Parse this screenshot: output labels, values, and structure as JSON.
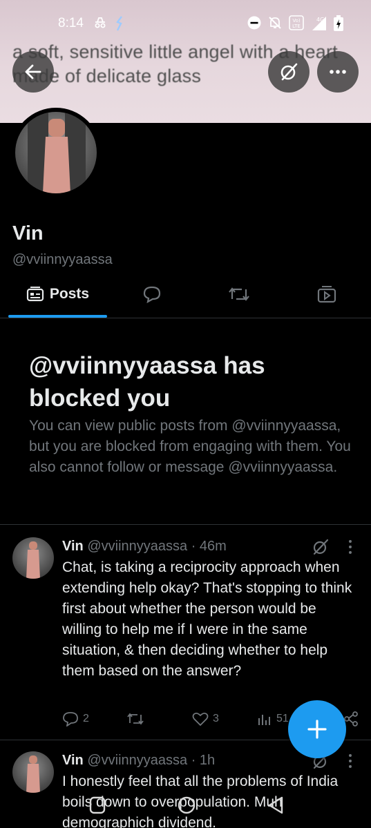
{
  "status_bar": {
    "time": "8:14",
    "network": "4G"
  },
  "banner": {
    "text": "a soft, sensitive little angel with a heart made of delicate glass"
  },
  "profile": {
    "name": "Vin",
    "handle": "@vviinnyyaassa"
  },
  "tabs": [
    {
      "label": "Posts",
      "icon": "posts-icon",
      "selected": true
    },
    {
      "label": "",
      "icon": "replies-icon"
    },
    {
      "label": "",
      "icon": "reposts-icon"
    },
    {
      "label": "",
      "icon": "media-icon"
    }
  ],
  "blocked_notice": {
    "title": "@vviinnyyaassa has blocked you",
    "description": "You can view public posts from @vviinnyyaassa, but you are blocked from engaging with them. You also cannot follow or message @vviinnyyaassa."
  },
  "posts": [
    {
      "name": "Vin",
      "handle": "@vviinnyyaassa",
      "time": "· 46m",
      "body": "Chat, is taking a reciprocity approach when extending help okay? That's stopping to think first about whether the person would be willing to help me if I were in the same situation, & then deciding whether to help them based on the answer?",
      "replies": "2",
      "reposts": "",
      "likes": "3",
      "views": "51"
    },
    {
      "name": "Vin",
      "handle": "@vviinnyyaassa",
      "time": "· 1h",
      "body": "I honestly feel that all the problems of India boils down to overpopulation. Muh demographich dividend."
    }
  ],
  "colors": {
    "accent": "#1d9bf0",
    "background": "#000000",
    "muted_text": "#71767b",
    "primary_text": "#e7e9ea"
  }
}
